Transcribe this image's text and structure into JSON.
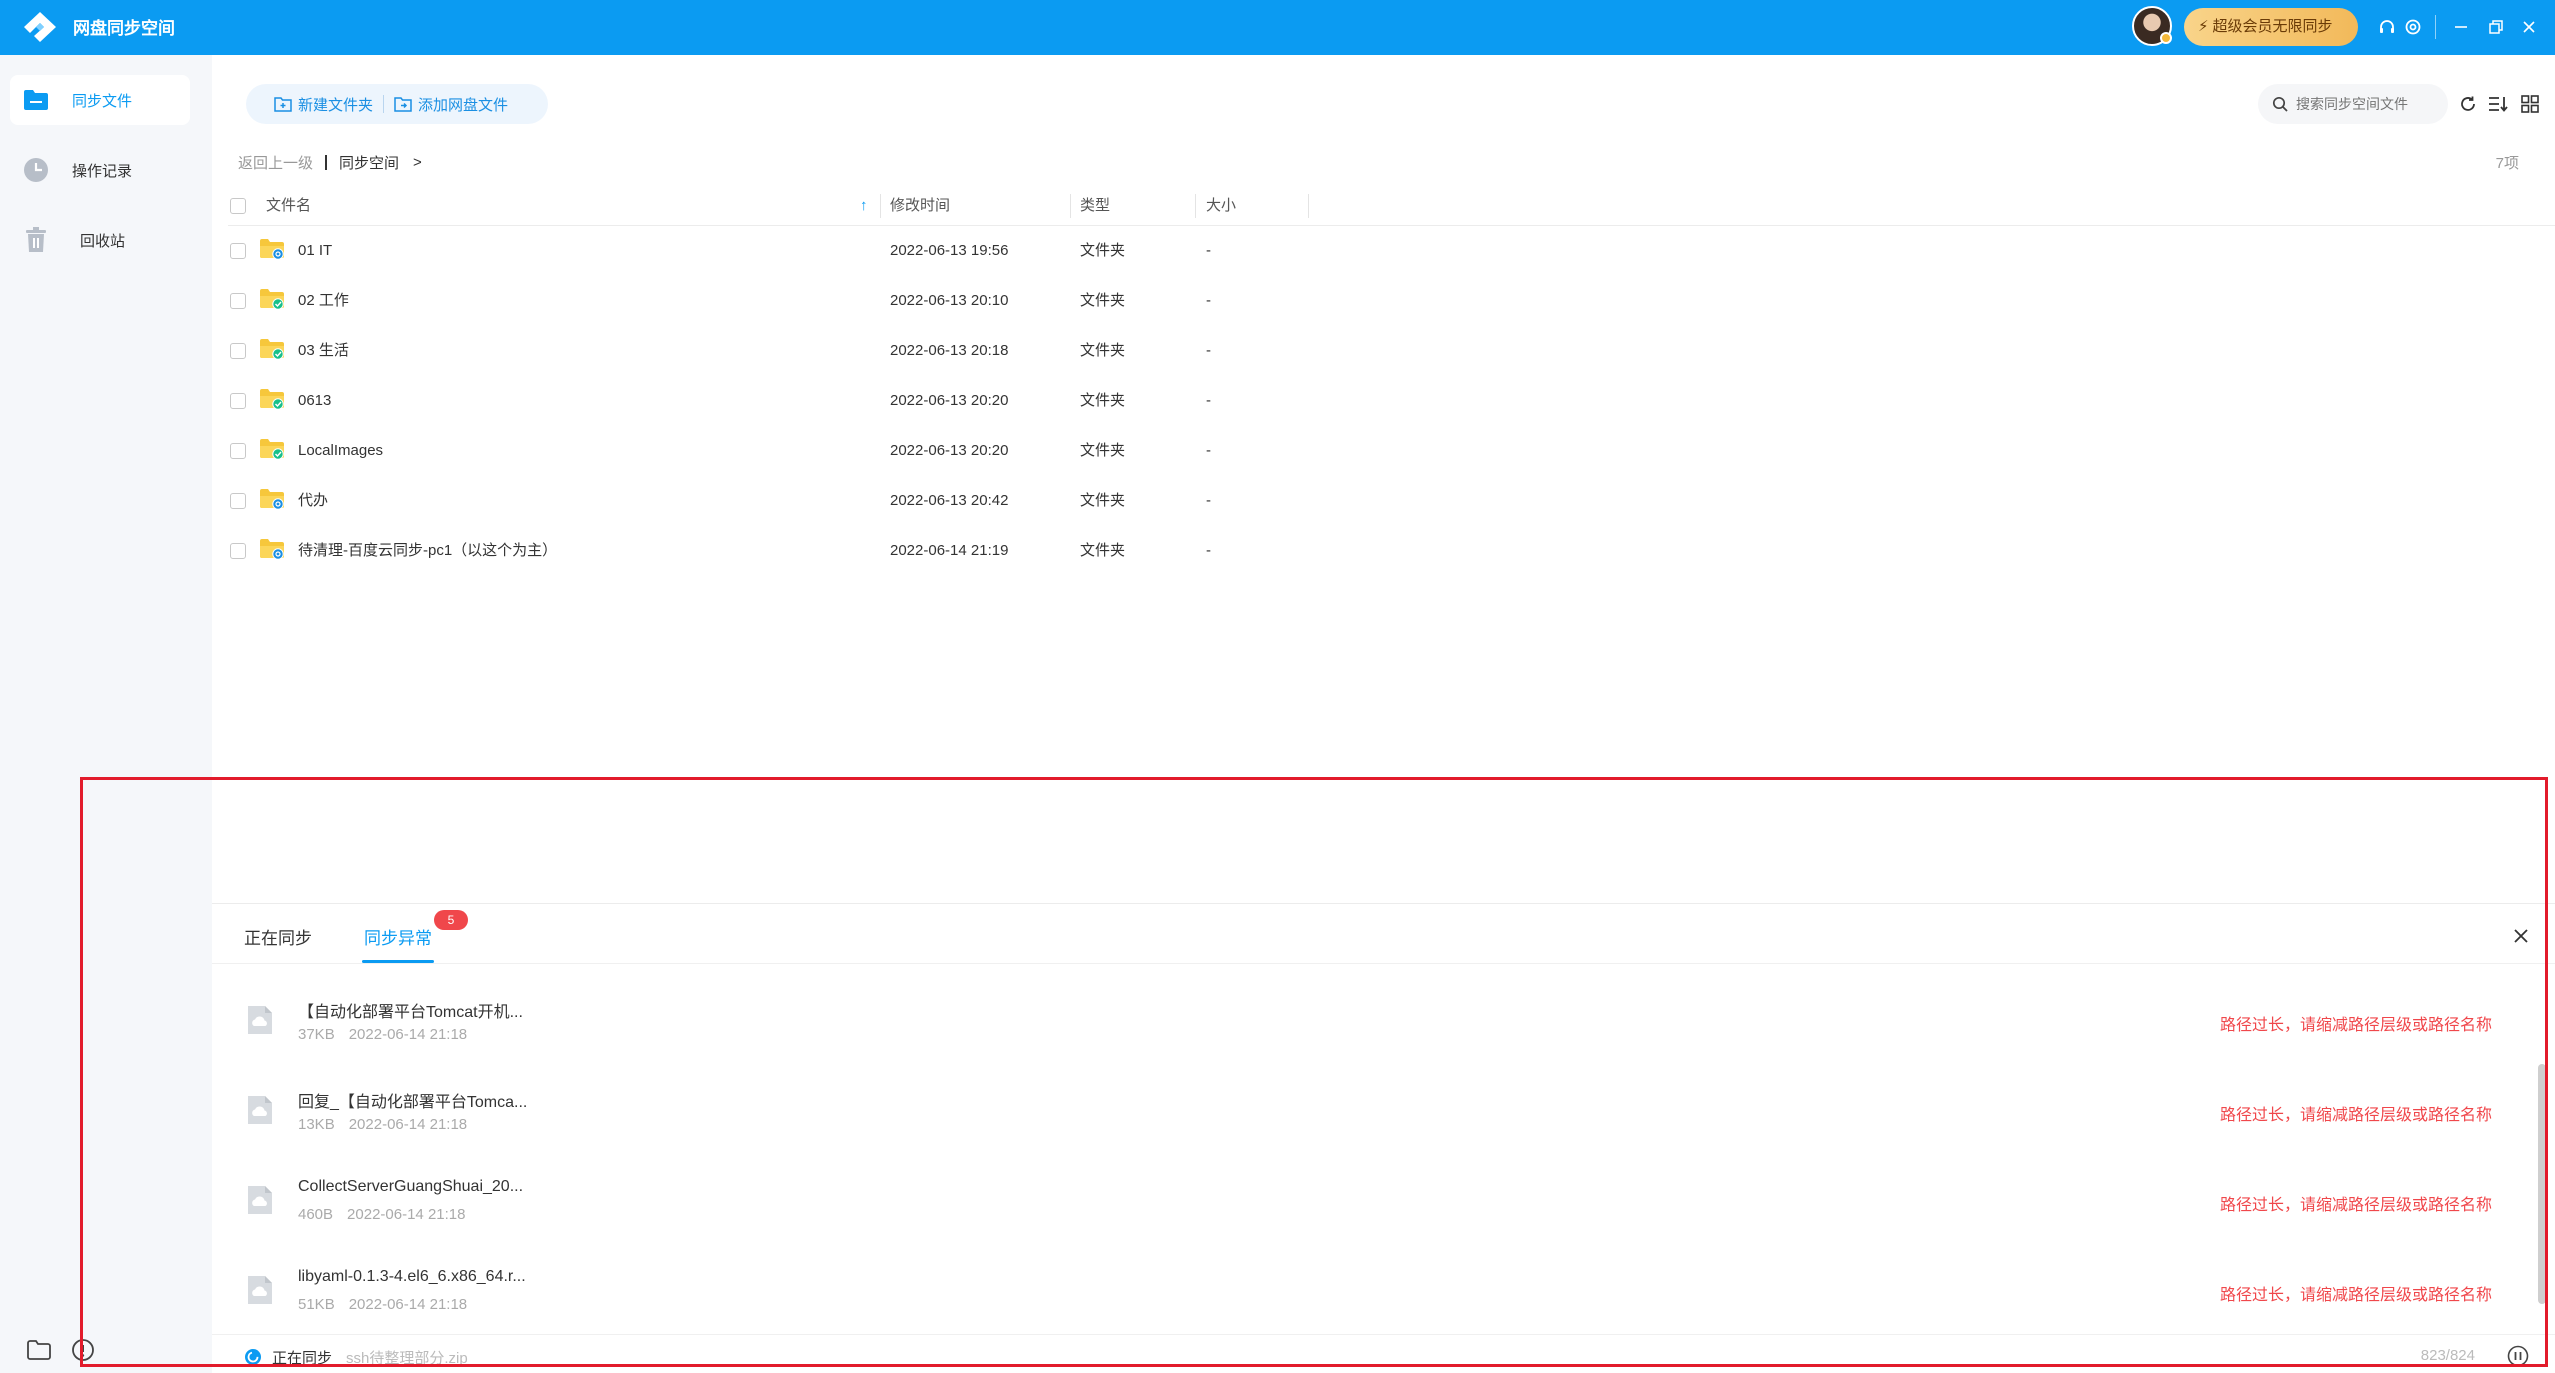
{
  "app": {
    "title": "网盘同步空间",
    "brand_color": "#0b9bf2"
  },
  "titlebar": {
    "vip_label": "超级会员无限同步"
  },
  "sidebar": {
    "items": [
      {
        "label": "同步文件",
        "icon": "sync-folder-icon",
        "active": true
      },
      {
        "label": "操作记录",
        "icon": "clock-icon",
        "active": false
      },
      {
        "label": "回收站",
        "icon": "trash-icon",
        "active": false
      }
    ]
  },
  "toolbar": {
    "new_folder": "新建文件夹",
    "add_cloud_file": "添加网盘文件",
    "search_placeholder": "搜索同步空间文件"
  },
  "breadcrumb": {
    "back": "返回上一级",
    "current": "同步空间",
    "arrow": ">"
  },
  "item_count": "7项",
  "table": {
    "columns": {
      "name": "文件名",
      "modified": "修改时间",
      "type": "类型",
      "size": "大小"
    },
    "sort_arrow": "↑",
    "rows": [
      {
        "name": "01 IT",
        "modified": "2022-06-13 19:56",
        "type": "文件夹",
        "size": "-",
        "status": "syncing"
      },
      {
        "name": "02 工作",
        "modified": "2022-06-13 20:10",
        "type": "文件夹",
        "size": "-",
        "status": "synced"
      },
      {
        "name": "03 生活",
        "modified": "2022-06-13 20:18",
        "type": "文件夹",
        "size": "-",
        "status": "synced"
      },
      {
        "name": "0613",
        "modified": "2022-06-13 20:20",
        "type": "文件夹",
        "size": "-",
        "status": "synced"
      },
      {
        "name": "LocalImages",
        "modified": "2022-06-13 20:20",
        "type": "文件夹",
        "size": "-",
        "status": "synced"
      },
      {
        "name": "代办",
        "modified": "2022-06-13 20:42",
        "type": "文件夹",
        "size": "-",
        "status": "syncing"
      },
      {
        "name": "待清理-百度云同步-pc1（以这个为主）",
        "modified": "2022-06-14 21:19",
        "type": "文件夹",
        "size": "-",
        "status": "syncing"
      }
    ]
  },
  "sync_panel": {
    "tabs": [
      {
        "label": "正在同步",
        "active": false
      },
      {
        "label": "同步异常",
        "active": true,
        "badge": "5"
      }
    ],
    "errors": [
      {
        "name": "【自动化部署平台Tomcat开机...",
        "size": "37KB",
        "time": "2022-06-14 21:18",
        "message": "路径过长，请缩减路径层级或路径名称"
      },
      {
        "name": "回复_【自动化部署平台Tomca...",
        "size": "13KB",
        "time": "2022-06-14 21:18",
        "message": "路径过长，请缩减路径层级或路径名称"
      },
      {
        "name": "CollectServerGuangShuai_20...",
        "size": "460B",
        "time": "2022-06-14 21:18",
        "message": "路径过长，请缩减路径层级或路径名称"
      },
      {
        "name": "libyaml-0.1.3-4.el6_6.x86_64.r...",
        "size": "51KB",
        "time": "2022-06-14 21:18",
        "message": "路径过长，请缩减路径层级或路径名称"
      }
    ],
    "status": {
      "label": "正在同步",
      "file": "ssh待整理部分.zip",
      "progress": "823/824"
    }
  }
}
